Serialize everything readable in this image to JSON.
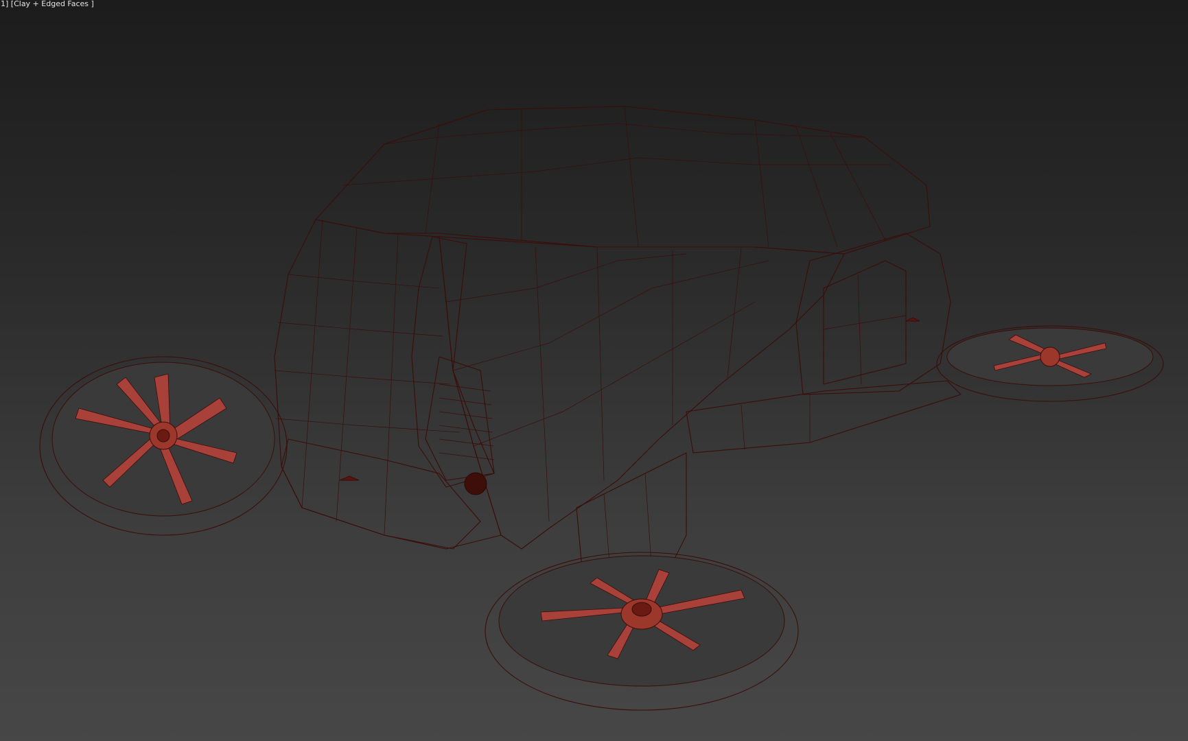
{
  "viewport": {
    "label": "1] [Clay + Edged Faces ]",
    "background_top": "#1c1c1c",
    "background_bottom": "#474747"
  },
  "model": {
    "material_color": "#b0463a",
    "wire_color": "#3a0d08",
    "parts": [
      "cabin-body",
      "front-window",
      "rear-pod",
      "wing-arm",
      "rear-strut",
      "rotor-left",
      "rotor-right",
      "rotor-front"
    ]
  }
}
